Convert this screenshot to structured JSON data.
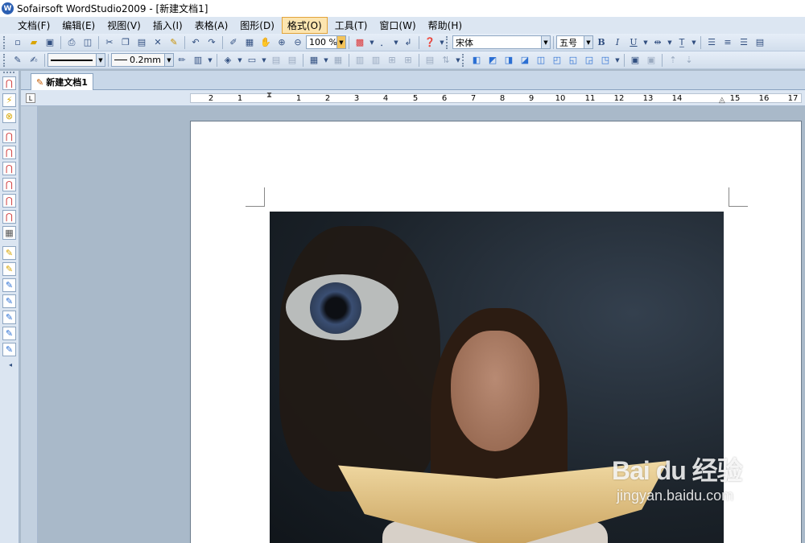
{
  "window": {
    "title": "Sofairsoft WordStudio2009 - [新建文档1]",
    "app_icon": "W"
  },
  "menu": [
    {
      "label": "文档(F)"
    },
    {
      "label": "编辑(E)"
    },
    {
      "label": "视图(V)"
    },
    {
      "label": "插入(I)"
    },
    {
      "label": "表格(A)"
    },
    {
      "label": "图形(D)"
    },
    {
      "label": "格式(O)",
      "active": true
    },
    {
      "label": "工具(T)"
    },
    {
      "label": "窗口(W)"
    },
    {
      "label": "帮助(H)"
    }
  ],
  "toolbar1": {
    "zoom": "100 %",
    "font": "宋体",
    "size": "五号",
    "bold": "B",
    "italic": "I",
    "underline": "U"
  },
  "toolbar2": {
    "line_width": "0.2mm"
  },
  "doc_tab": {
    "label": "新建文档1"
  },
  "ruler": {
    "labels": [
      "2",
      "1",
      "1",
      "2",
      "3",
      "4",
      "5",
      "6",
      "7",
      "8",
      "9",
      "10",
      "11",
      "12",
      "13",
      "14",
      "15",
      "16",
      "17",
      "18"
    ]
  },
  "icons": {
    "colors": {
      "accent": "#2b5fb3",
      "menu_active_bg": "#fce5b0",
      "page_bg": "#ffffff",
      "workspace_bg": "#a9b9c9"
    }
  },
  "document": {
    "image_description": "photo of woman reading book with eye in background"
  },
  "watermark": {
    "logo": "Bai du 经验",
    "url": "jingyan.baidu.com"
  }
}
